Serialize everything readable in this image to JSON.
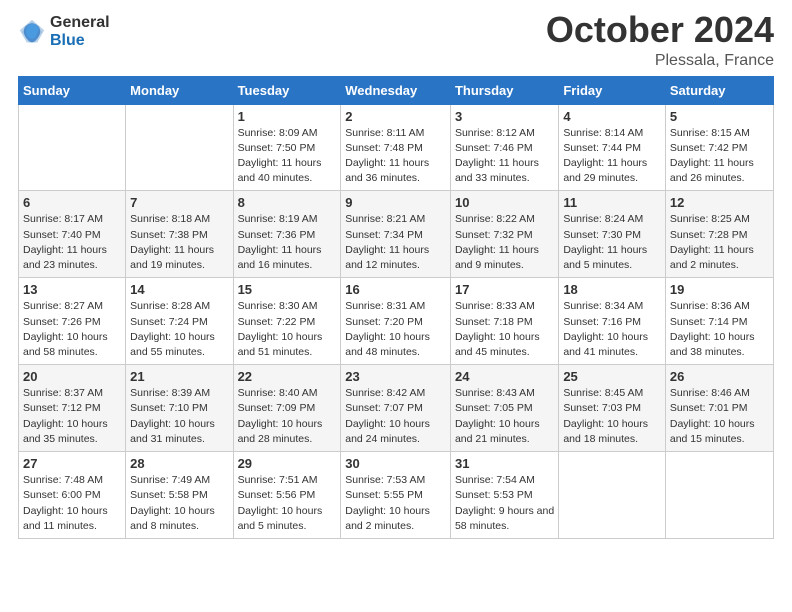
{
  "header": {
    "logo_general": "General",
    "logo_blue": "Blue",
    "title": "October 2024",
    "location": "Plessala, France"
  },
  "days_of_week": [
    "Sunday",
    "Monday",
    "Tuesday",
    "Wednesday",
    "Thursday",
    "Friday",
    "Saturday"
  ],
  "weeks": [
    [
      {
        "day": "",
        "sunrise": "",
        "sunset": "",
        "daylight": ""
      },
      {
        "day": "",
        "sunrise": "",
        "sunset": "",
        "daylight": ""
      },
      {
        "day": "1",
        "sunrise": "Sunrise: 8:09 AM",
        "sunset": "Sunset: 7:50 PM",
        "daylight": "Daylight: 11 hours and 40 minutes."
      },
      {
        "day": "2",
        "sunrise": "Sunrise: 8:11 AM",
        "sunset": "Sunset: 7:48 PM",
        "daylight": "Daylight: 11 hours and 36 minutes."
      },
      {
        "day": "3",
        "sunrise": "Sunrise: 8:12 AM",
        "sunset": "Sunset: 7:46 PM",
        "daylight": "Daylight: 11 hours and 33 minutes."
      },
      {
        "day": "4",
        "sunrise": "Sunrise: 8:14 AM",
        "sunset": "Sunset: 7:44 PM",
        "daylight": "Daylight: 11 hours and 29 minutes."
      },
      {
        "day": "5",
        "sunrise": "Sunrise: 8:15 AM",
        "sunset": "Sunset: 7:42 PM",
        "daylight": "Daylight: 11 hours and 26 minutes."
      }
    ],
    [
      {
        "day": "6",
        "sunrise": "Sunrise: 8:17 AM",
        "sunset": "Sunset: 7:40 PM",
        "daylight": "Daylight: 11 hours and 23 minutes."
      },
      {
        "day": "7",
        "sunrise": "Sunrise: 8:18 AM",
        "sunset": "Sunset: 7:38 PM",
        "daylight": "Daylight: 11 hours and 19 minutes."
      },
      {
        "day": "8",
        "sunrise": "Sunrise: 8:19 AM",
        "sunset": "Sunset: 7:36 PM",
        "daylight": "Daylight: 11 hours and 16 minutes."
      },
      {
        "day": "9",
        "sunrise": "Sunrise: 8:21 AM",
        "sunset": "Sunset: 7:34 PM",
        "daylight": "Daylight: 11 hours and 12 minutes."
      },
      {
        "day": "10",
        "sunrise": "Sunrise: 8:22 AM",
        "sunset": "Sunset: 7:32 PM",
        "daylight": "Daylight: 11 hours and 9 minutes."
      },
      {
        "day": "11",
        "sunrise": "Sunrise: 8:24 AM",
        "sunset": "Sunset: 7:30 PM",
        "daylight": "Daylight: 11 hours and 5 minutes."
      },
      {
        "day": "12",
        "sunrise": "Sunrise: 8:25 AM",
        "sunset": "Sunset: 7:28 PM",
        "daylight": "Daylight: 11 hours and 2 minutes."
      }
    ],
    [
      {
        "day": "13",
        "sunrise": "Sunrise: 8:27 AM",
        "sunset": "Sunset: 7:26 PM",
        "daylight": "Daylight: 10 hours and 58 minutes."
      },
      {
        "day": "14",
        "sunrise": "Sunrise: 8:28 AM",
        "sunset": "Sunset: 7:24 PM",
        "daylight": "Daylight: 10 hours and 55 minutes."
      },
      {
        "day": "15",
        "sunrise": "Sunrise: 8:30 AM",
        "sunset": "Sunset: 7:22 PM",
        "daylight": "Daylight: 10 hours and 51 minutes."
      },
      {
        "day": "16",
        "sunrise": "Sunrise: 8:31 AM",
        "sunset": "Sunset: 7:20 PM",
        "daylight": "Daylight: 10 hours and 48 minutes."
      },
      {
        "day": "17",
        "sunrise": "Sunrise: 8:33 AM",
        "sunset": "Sunset: 7:18 PM",
        "daylight": "Daylight: 10 hours and 45 minutes."
      },
      {
        "day": "18",
        "sunrise": "Sunrise: 8:34 AM",
        "sunset": "Sunset: 7:16 PM",
        "daylight": "Daylight: 10 hours and 41 minutes."
      },
      {
        "day": "19",
        "sunrise": "Sunrise: 8:36 AM",
        "sunset": "Sunset: 7:14 PM",
        "daylight": "Daylight: 10 hours and 38 minutes."
      }
    ],
    [
      {
        "day": "20",
        "sunrise": "Sunrise: 8:37 AM",
        "sunset": "Sunset: 7:12 PM",
        "daylight": "Daylight: 10 hours and 35 minutes."
      },
      {
        "day": "21",
        "sunrise": "Sunrise: 8:39 AM",
        "sunset": "Sunset: 7:10 PM",
        "daylight": "Daylight: 10 hours and 31 minutes."
      },
      {
        "day": "22",
        "sunrise": "Sunrise: 8:40 AM",
        "sunset": "Sunset: 7:09 PM",
        "daylight": "Daylight: 10 hours and 28 minutes."
      },
      {
        "day": "23",
        "sunrise": "Sunrise: 8:42 AM",
        "sunset": "Sunset: 7:07 PM",
        "daylight": "Daylight: 10 hours and 24 minutes."
      },
      {
        "day": "24",
        "sunrise": "Sunrise: 8:43 AM",
        "sunset": "Sunset: 7:05 PM",
        "daylight": "Daylight: 10 hours and 21 minutes."
      },
      {
        "day": "25",
        "sunrise": "Sunrise: 8:45 AM",
        "sunset": "Sunset: 7:03 PM",
        "daylight": "Daylight: 10 hours and 18 minutes."
      },
      {
        "day": "26",
        "sunrise": "Sunrise: 8:46 AM",
        "sunset": "Sunset: 7:01 PM",
        "daylight": "Daylight: 10 hours and 15 minutes."
      }
    ],
    [
      {
        "day": "27",
        "sunrise": "Sunrise: 7:48 AM",
        "sunset": "Sunset: 6:00 PM",
        "daylight": "Daylight: 10 hours and 11 minutes."
      },
      {
        "day": "28",
        "sunrise": "Sunrise: 7:49 AM",
        "sunset": "Sunset: 5:58 PM",
        "daylight": "Daylight: 10 hours and 8 minutes."
      },
      {
        "day": "29",
        "sunrise": "Sunrise: 7:51 AM",
        "sunset": "Sunset: 5:56 PM",
        "daylight": "Daylight: 10 hours and 5 minutes."
      },
      {
        "day": "30",
        "sunrise": "Sunrise: 7:53 AM",
        "sunset": "Sunset: 5:55 PM",
        "daylight": "Daylight: 10 hours and 2 minutes."
      },
      {
        "day": "31",
        "sunrise": "Sunrise: 7:54 AM",
        "sunset": "Sunset: 5:53 PM",
        "daylight": "Daylight: 9 hours and 58 minutes."
      },
      {
        "day": "",
        "sunrise": "",
        "sunset": "",
        "daylight": ""
      },
      {
        "day": "",
        "sunrise": "",
        "sunset": "",
        "daylight": ""
      }
    ]
  ]
}
